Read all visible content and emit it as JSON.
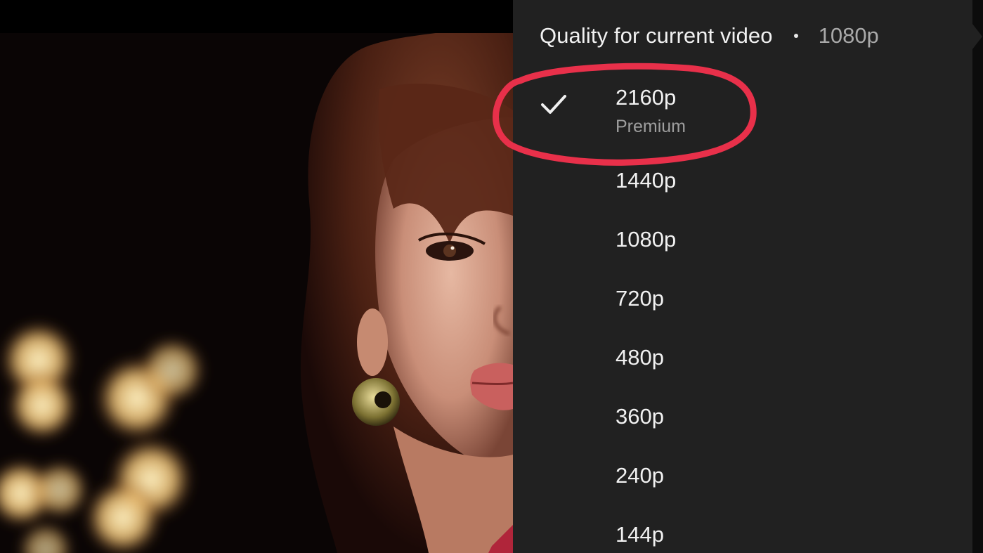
{
  "quality_menu": {
    "title": "Quality for current video",
    "current_quality": "1080p",
    "selected_index": 0,
    "options": [
      {
        "label": "2160p",
        "sublabel": "Premium",
        "selected": true
      },
      {
        "label": "1440p"
      },
      {
        "label": "1080p"
      },
      {
        "label": "720p"
      },
      {
        "label": "480p"
      },
      {
        "label": "360p"
      },
      {
        "label": "240p"
      },
      {
        "label": "144p"
      }
    ]
  },
  "icons": {
    "selected_marker": "checkmark-icon",
    "header_separator": "dot-separator-icon"
  },
  "colors": {
    "panel_background": "#212121",
    "text_primary": "#f1f1f1",
    "text_secondary": "#9e9e9e",
    "annotation_circle": "#e8304a"
  }
}
